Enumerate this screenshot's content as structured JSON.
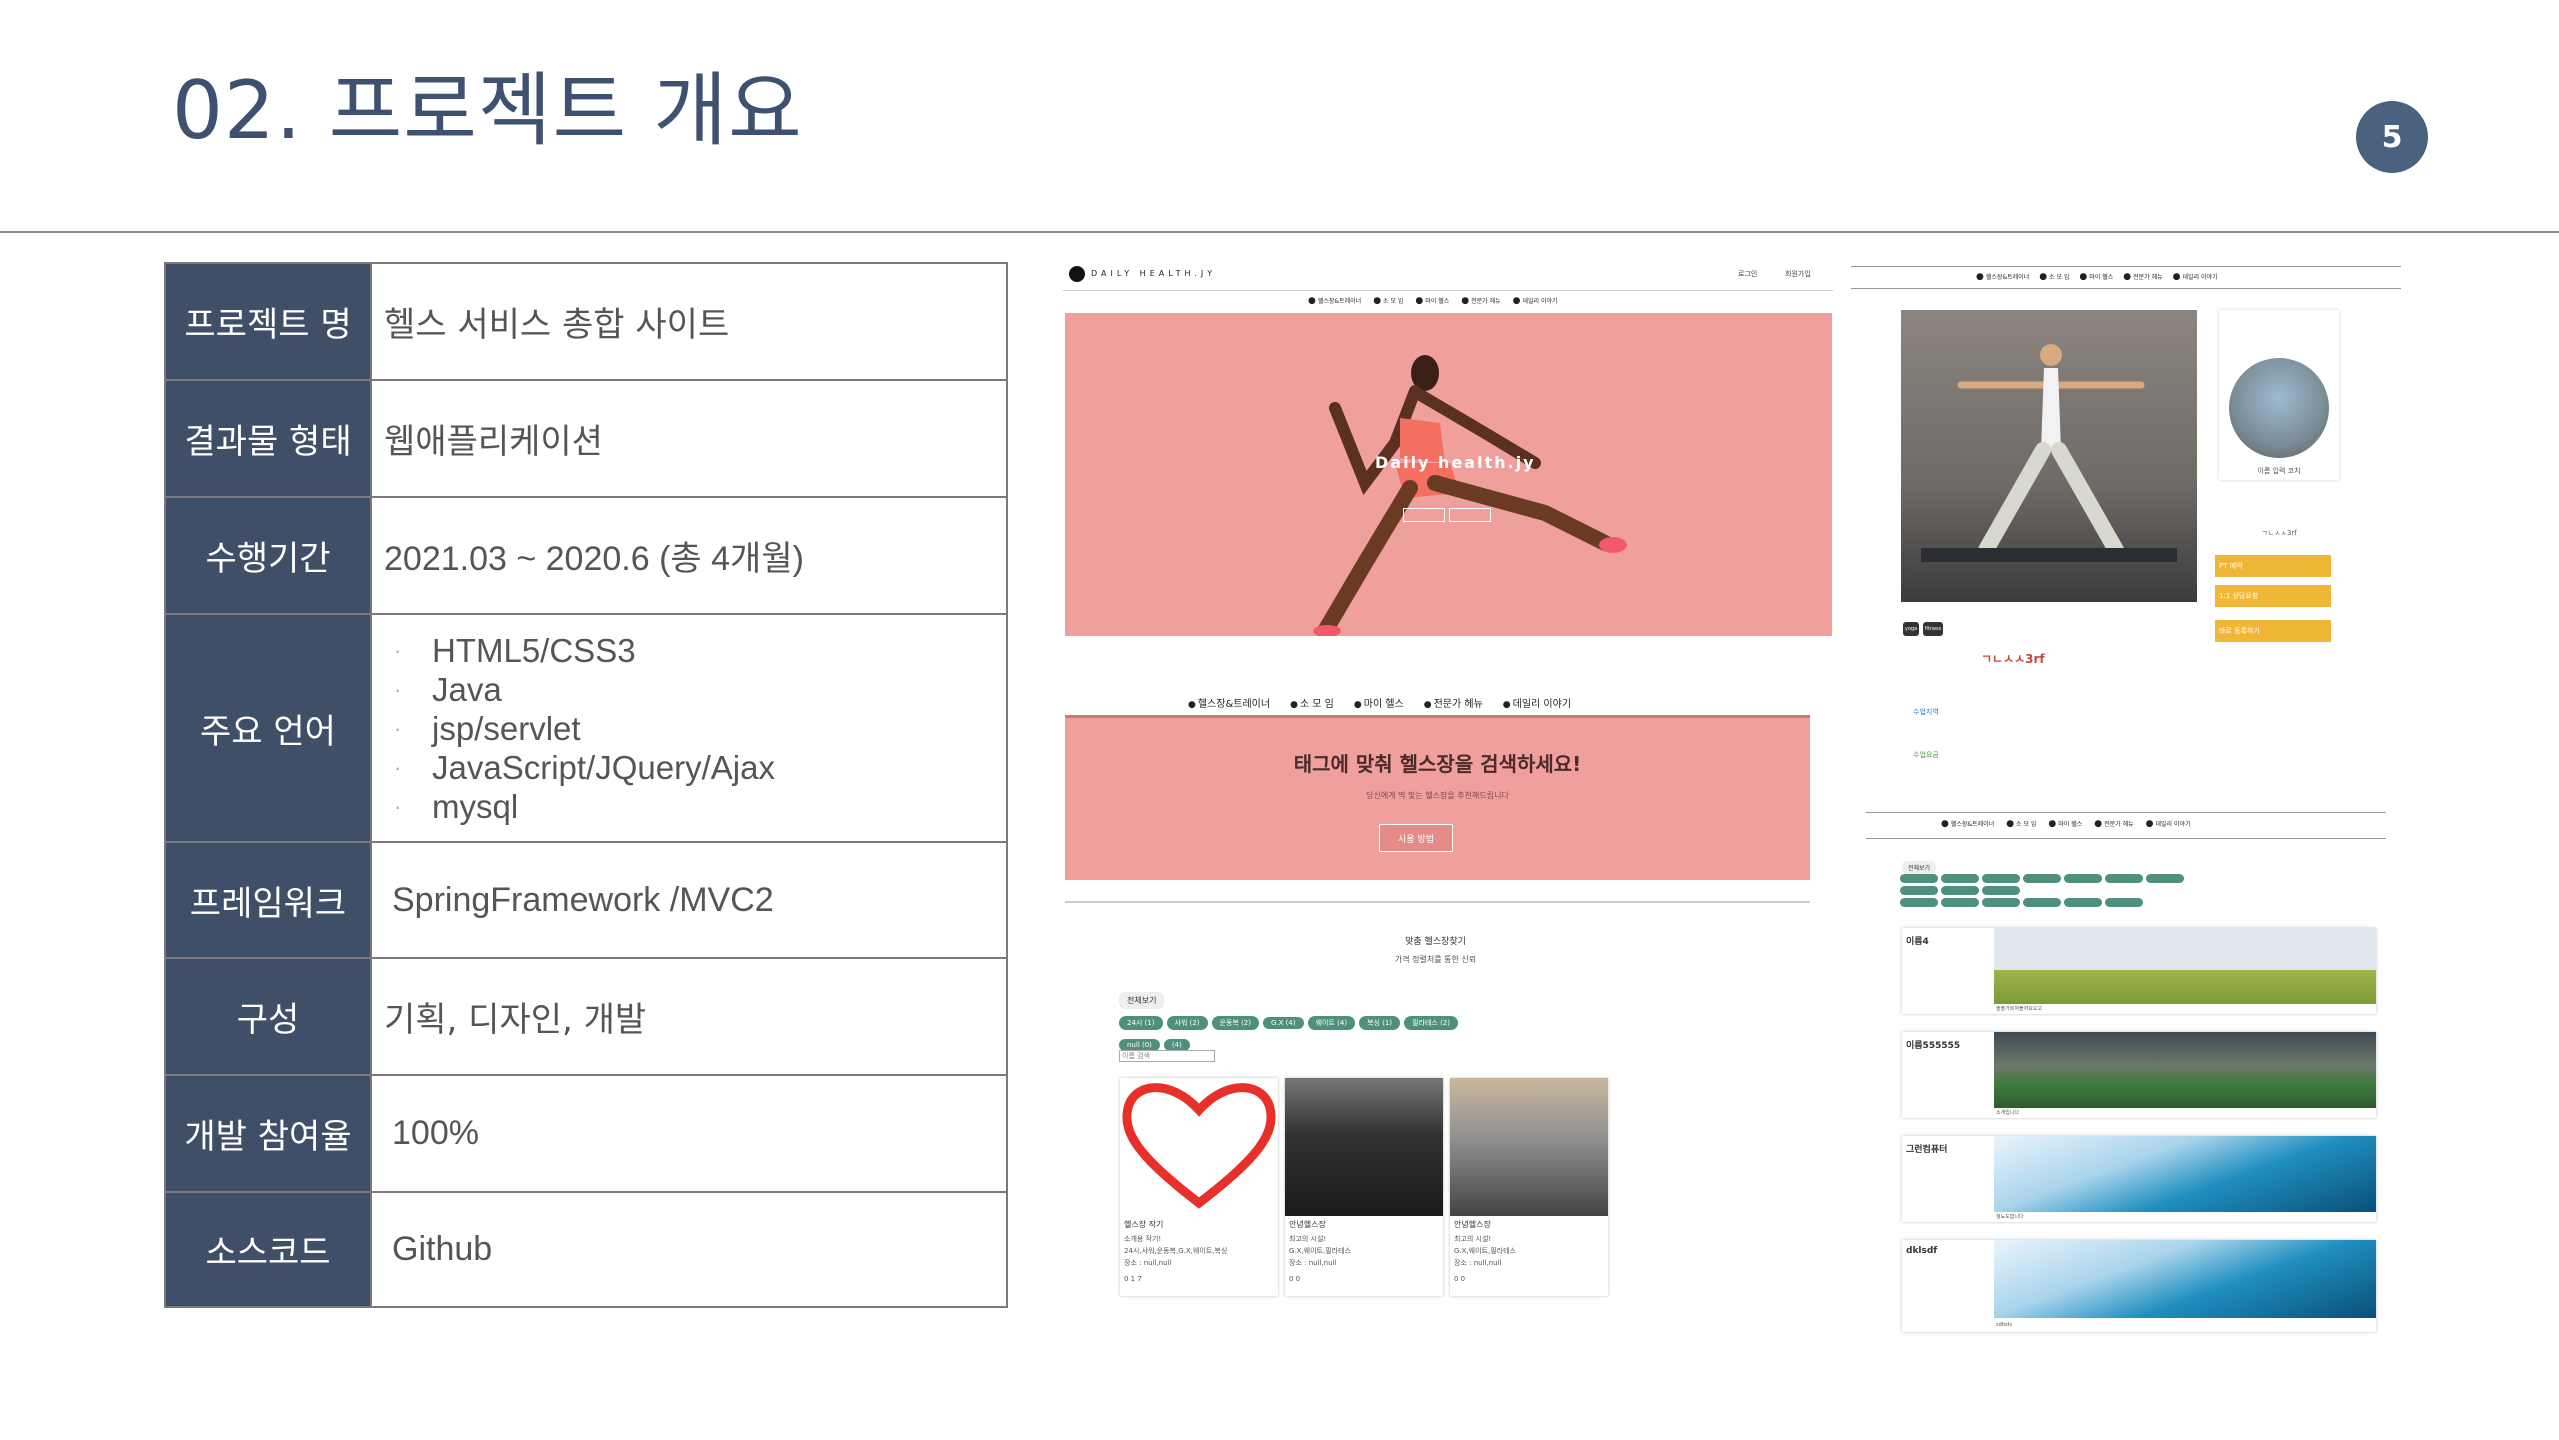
{
  "slide": {
    "title": "02. 프로젝트 개요",
    "page_number": "5"
  },
  "info_table": {
    "rows": [
      {
        "label": "프로젝트 명",
        "value": "헬스 서비스 총합 사이트"
      },
      {
        "label": "결과물 형태",
        "value": "웹애플리케이션"
      },
      {
        "label": "수행기간",
        "value": "2021.03 ~ 2020.6 (총 4개월)"
      },
      {
        "label": "주요 언어",
        "items": [
          "HTML5/CSS3",
          "Java",
          "jsp/servlet",
          "JavaScript/JQuery/Ajax",
          "mysql"
        ]
      },
      {
        "label": "프레임워크",
        "value": "SpringFramework /MVC2"
      },
      {
        "label": "구성",
        "value": "기획, 디자인, 개발"
      },
      {
        "label": "개발 참여율",
        "value": "100%"
      },
      {
        "label": "소스코드",
        "value": "Github"
      }
    ]
  },
  "screenshot_main": {
    "logo": "DAILY HEALTH.JY",
    "top_links": [
      "로그인",
      "회원가입"
    ],
    "nav": [
      "헬스장&트레이너",
      "소 모 임",
      "마이 헬스",
      "전문가 헤뉴",
      "데일리 이야기"
    ],
    "hero_text": "Daily health.jy",
    "search_banner": {
      "heading": "태그에 맞춰 헬스장을 검색하세요!",
      "sub": "당신에게 딱 맞는 헬스장을 추천해드립니다",
      "button": "사용 방법"
    },
    "gym_section": {
      "title": "맞춤 헬스장찾기",
      "subtitle": "가격 정렬처를 통한 신뢰",
      "view_all": "전체보기",
      "chips": [
        "24시 (1)",
        "샤워 (2)",
        "운동복 (2)",
        "G.X (4)",
        "웨이트 (4)",
        "복싱 (1)",
        "필라테스 (2)",
        "null (0)",
        "(4)"
      ],
      "search_placeholder": "이름 검색",
      "cards": [
        {
          "name": "헬스장 작기",
          "lines": [
            "소개용 작기!",
            "24시,샤워,운동복,G.X,웨이트,복싱",
            "장소 : null,null"
          ],
          "stats": "0 1  7"
        },
        {
          "name": "안녕헬스장",
          "lines": [
            "최고의 시설!",
            "G.X,웨이트,필라테스",
            "장소 : null,null"
          ],
          "stats": "0  0"
        },
        {
          "name": "안녕헬스장",
          "lines": [
            "최고의 시설!",
            "G.X,웨이트,필라테스",
            "장소 : null,null"
          ],
          "stats": "0  0"
        }
      ]
    }
  },
  "screenshot_trainer": {
    "nav": [
      "헬스장&트레이너",
      "소 모 임",
      "마이 헬스",
      "전문가 헤뉴",
      "데일리 이야기"
    ],
    "name": "ㄱㄴㅅㅅ3rf",
    "tags": [
      "yoga",
      "fitness"
    ],
    "side_caption": "이름 입력 코치",
    "side_text": "ㄱㄴㅅㅅ3rf",
    "buttons": [
      "PT 예약",
      "1:1 상담요청",
      "바로 등록하기"
    ],
    "detail_lines": [
      "수업지역",
      "수업요금"
    ]
  },
  "screenshot_list": {
    "nav": [
      "헬스장&트레이너",
      "소 모 임",
      "마이 헬스",
      "전문가 헤뉴",
      "데일리 이야기"
    ],
    "view_all": "전체보기",
    "entries": [
      {
        "name": "이름4",
        "note": "솔솔가르쳐볼까요오고"
      },
      {
        "name": "이름555555",
        "note": "소개입니다"
      },
      {
        "name": "그런컴퓨터",
        "note": "월뇨도합니다"
      },
      {
        "name": "dklsdf",
        "note": "sdfsdv"
      }
    ]
  }
}
